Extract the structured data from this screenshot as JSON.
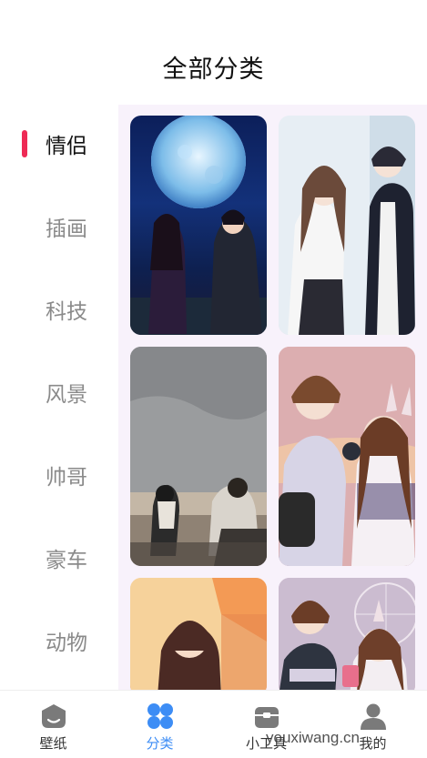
{
  "header": {
    "title": "全部分类"
  },
  "sidebar": {
    "items": [
      {
        "label": "情侣",
        "active": true
      },
      {
        "label": "插画",
        "active": false
      },
      {
        "label": "科技",
        "active": false
      },
      {
        "label": "风景",
        "active": false
      },
      {
        "label": "帅哥",
        "active": false
      },
      {
        "label": "豪车",
        "active": false
      },
      {
        "label": "动物",
        "active": false
      }
    ]
  },
  "grid": {
    "images": [
      {
        "icon": "couple-moon-illustration"
      },
      {
        "icon": "couple-window-illustration"
      },
      {
        "icon": "couple-beach-photo"
      },
      {
        "icon": "couple-cat-illustration"
      },
      {
        "icon": "girl-sunset-illustration"
      },
      {
        "icon": "couple-ferris-wheel-illustration"
      }
    ]
  },
  "tabbar": {
    "tabs": [
      {
        "label": "壁纸",
        "icon": "wallpaper-icon",
        "active": false
      },
      {
        "label": "分类",
        "icon": "category-icon",
        "active": true
      },
      {
        "label": "小工具",
        "icon": "toolbox-icon",
        "active": false
      },
      {
        "label": "我的",
        "icon": "profile-icon",
        "active": false
      }
    ]
  },
  "watermark": "youxiwang.cn",
  "colors": {
    "accent": "#ee2a55",
    "tab_active": "#3d8df5",
    "grid_bg": "#f8f2fb"
  }
}
